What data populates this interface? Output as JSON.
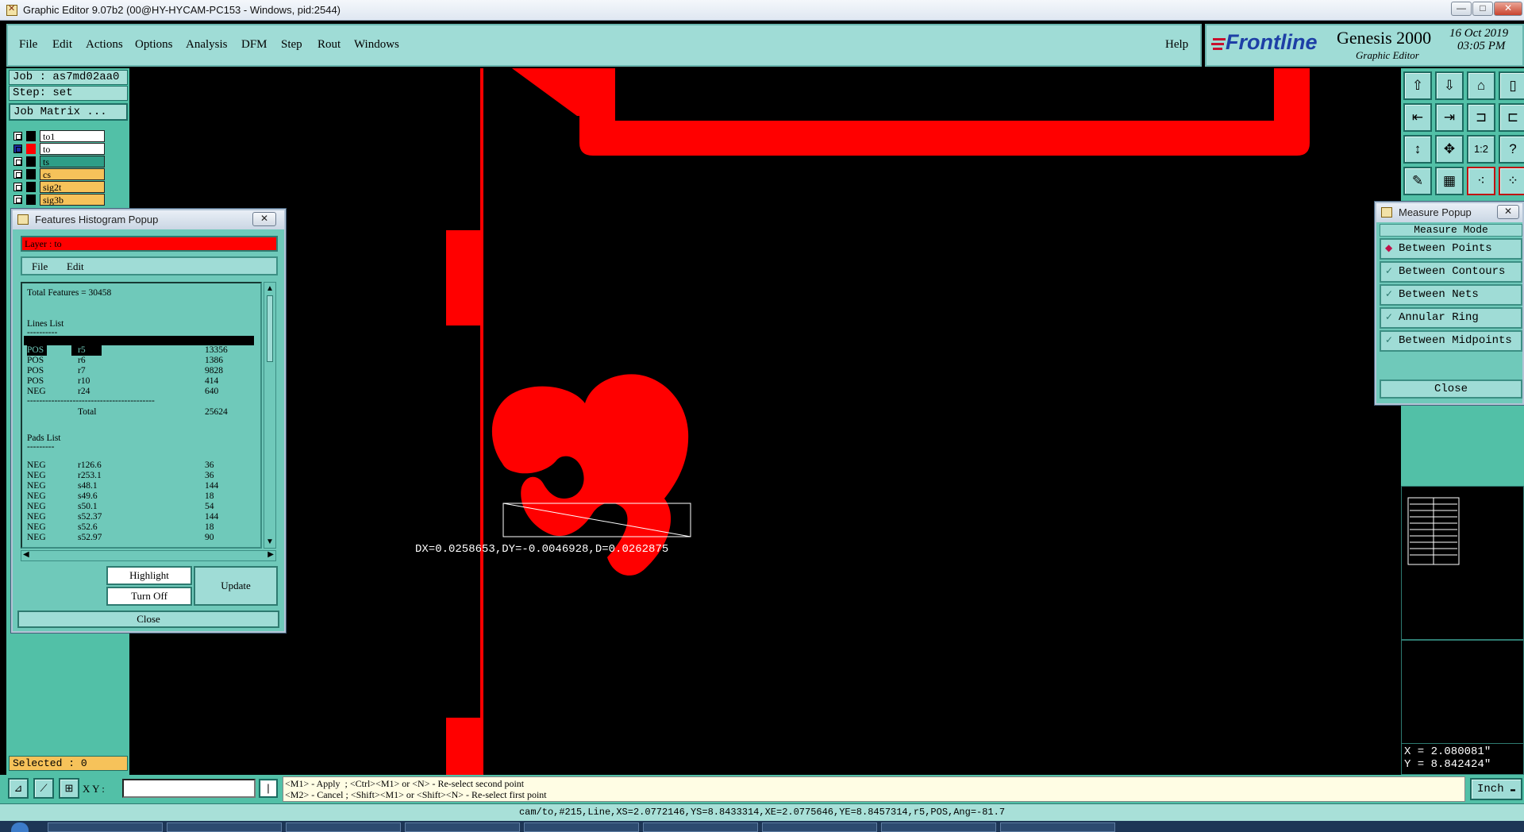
{
  "window": {
    "title": "Graphic Editor 9.07b2 (00@HY-HYCAM-PC153 - Windows, pid:2544)",
    "min_label": "—",
    "max_label": "□",
    "close_label": "✕"
  },
  "menubar": {
    "items": [
      "File",
      "Edit",
      "Actions",
      "Options",
      "Analysis",
      "DFM",
      "Step",
      "Rout",
      "Windows"
    ],
    "help": "Help"
  },
  "brand": {
    "logo": "Frontline",
    "product": "Genesis 2000",
    "subtitle": "Graphic Editor",
    "date": "16 Oct 2019",
    "time": "03:05 PM"
  },
  "job": {
    "job_label": "Job : as7md02aa0",
    "step_label": "Step: set",
    "matrix_button": "Job Matrix ..."
  },
  "layers": [
    {
      "name": "to1",
      "swatch": "#000000",
      "bg": "#ffffff"
    },
    {
      "name": "to",
      "swatch": "#ff0000",
      "bg": "#ffffff"
    },
    {
      "name": "ts",
      "swatch": "#000000",
      "bg": "#2e9e87"
    },
    {
      "name": "cs",
      "swatch": "#000000",
      "bg": "#f6c25a"
    },
    {
      "name": "sig2t",
      "swatch": "#000000",
      "bg": "#f6c25a"
    },
    {
      "name": "sig3b",
      "swatch": "#000000",
      "bg": "#f6c25a"
    }
  ],
  "selected": "Selected : 0",
  "histogram": {
    "title": "Features Histogram Popup",
    "close": "✕",
    "layer": "Layer :  to",
    "menu": [
      "File",
      "Edit"
    ],
    "total": "Total Features = 30458",
    "lines_header": "Lines List",
    "underline": "----------",
    "lines": [
      {
        "pol": "POS",
        "sym": "r5",
        "count": "13356"
      },
      {
        "pol": "POS",
        "sym": "r6",
        "count": "1386"
      },
      {
        "pol": "POS",
        "sym": "r7",
        "count": "9828"
      },
      {
        "pol": "POS",
        "sym": "r10",
        "count": "414"
      },
      {
        "pol": "NEG",
        "sym": "r24",
        "count": "640"
      }
    ],
    "separator": "------------------------------------------",
    "total_label": "Total",
    "total_value": "25624",
    "pads_header": "Pads List",
    "pads_underline": "---------",
    "pads": [
      {
        "pol": "NEG",
        "sym": "r126.6",
        "count": "36"
      },
      {
        "pol": "NEG",
        "sym": "r253.1",
        "count": "36"
      },
      {
        "pol": "NEG",
        "sym": "s48.1",
        "count": "144"
      },
      {
        "pol": "NEG",
        "sym": "s49.6",
        "count": "18"
      },
      {
        "pol": "NEG",
        "sym": "s50.1",
        "count": "54"
      },
      {
        "pol": "NEG",
        "sym": "s52.37",
        "count": "144"
      },
      {
        "pol": "NEG",
        "sym": "s52.6",
        "count": "18"
      },
      {
        "pol": "NEG",
        "sym": "s52.97",
        "count": "90"
      }
    ],
    "highlight": "Highlight",
    "turn_off": "Turn Off",
    "update": "Update",
    "close_button": "Close"
  },
  "measure": {
    "title": "Measure Popup",
    "close": "✕",
    "mode_header": "Measure Mode",
    "options": [
      {
        "label": "Between Points",
        "selected": true
      },
      {
        "label": "Between Contours",
        "selected": false
      },
      {
        "label": "Between Nets",
        "selected": false
      },
      {
        "label": "Annular Ring",
        "selected": false
      },
      {
        "label": "Between Midpoints",
        "selected": false
      }
    ],
    "close_button": "Close"
  },
  "canvas": {
    "measure_readout": "DX=0.0258653,DY=-0.0046928,D=0.0262875"
  },
  "tools": [
    "⇧",
    "⇩",
    "⌂",
    "▯",
    "⇤",
    "⇥",
    "⊐",
    "⊏",
    "↕",
    "✥",
    "1:2",
    "?",
    "✎",
    "▦",
    "⁖",
    "⁘"
  ],
  "coords": {
    "x": "X = 2.080081\"",
    "y": "Y = 8.842424\""
  },
  "bottom": {
    "xy_label": "X Y :",
    "xy_value": "",
    "hint1": "<M1> - Apply  ; <Ctrl><M1> or <N> - Re-select second point",
    "hint2": "<M2> - Cancel ; <Shift><M1> or <Shift><N> - Re-select first point",
    "units": "Inch"
  },
  "status": "cam/to,#215,Line,XS=2.0772146,YS=8.8433314,XE=2.0775646,YE=8.8457314,r5,POS,Ang=-81.7",
  "colors": {
    "feature": "#ff0000",
    "panel": "#52c0a7",
    "button": "#9fdcd6"
  }
}
